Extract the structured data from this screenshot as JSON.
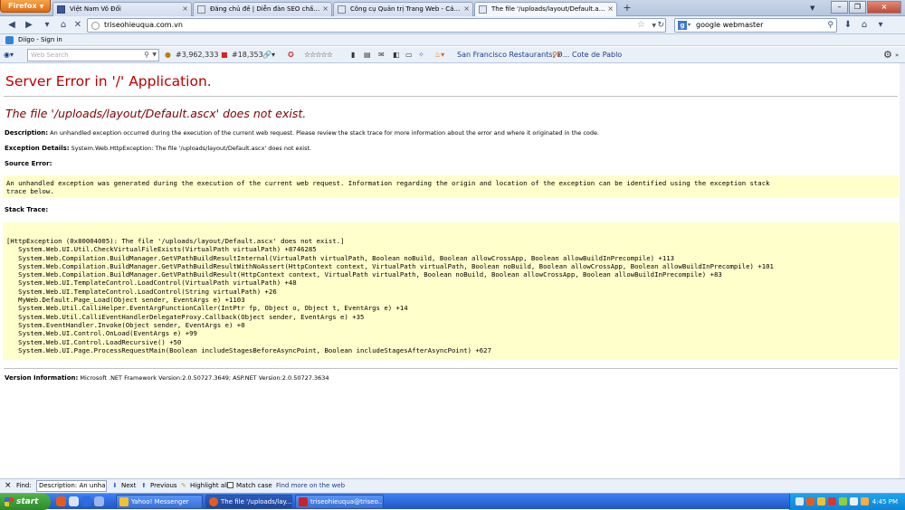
{
  "browser": {
    "menu_button": "Firefox",
    "tabs": [
      {
        "title": "Việt Nam Vô Đối",
        "active": false
      },
      {
        "title": "Đăng chủ đề | Diễn đàn SEO chất lượng ...",
        "active": false
      },
      {
        "title": "Công cụ Quản trị Trang Web - Các liên kế...",
        "active": false
      },
      {
        "title": "The file '/uploads/layout/Default.ascx' do...",
        "active": true
      }
    ],
    "new_tab": "+",
    "url": "triseohieuqua.com.vn",
    "search_engine_icon": "g-icon",
    "search_value": "google webmaster"
  },
  "diigo": {
    "label": "Diigo - Sign in"
  },
  "addon_toolbar": {
    "search_placeholder": "Web Search",
    "alexa_rank": "#3,962,333",
    "vn_rank": "#18,353",
    "stars": "☆☆☆☆☆",
    "restaurant_link": "San Francisco Restaurants, D...",
    "place_link": "Cote de Pablo"
  },
  "page": {
    "title": "Server Error in '/' Application.",
    "message": "The file '/uploads/layout/Default.ascx' does not exist.",
    "description_label": "Description:",
    "description_text": "An unhandled exception occurred during the execution of the current web request. Please review the stack trace for more information about the error and where it originated in the code.",
    "exception_label": "Exception Details:",
    "exception_text": "System.Web.HttpException: The file '/uploads/layout/Default.ascx' does not exist.",
    "source_error_label": "Source Error:",
    "source_error_lines": [
      "An unhandled exception was generated during the execution of the current web request. Information regarding the origin and location of the exception can be identified using the exception stack",
      "trace below."
    ],
    "stack_trace_label": "Stack Trace:",
    "stack_trace_lines": [
      "[HttpException (0x80004005): The file '/uploads/layout/Default.ascx' does not exist.]",
      "   System.Web.UI.Util.CheckVirtualFileExists(VirtualPath virtualPath) +8746285",
      "   System.Web.Compilation.BuildManager.GetVPathBuildResultInternal(VirtualPath virtualPath, Boolean noBuild, Boolean allowCrossApp, Boolean allowBuildInPrecompile) +113",
      "   System.Web.Compilation.BuildManager.GetVPathBuildResultWithNoAssert(HttpContext context, VirtualPath virtualPath, Boolean noBuild, Boolean allowCrossApp, Boolean allowBuildInPrecompile) +101",
      "   System.Web.Compilation.BuildManager.GetVPathBuildResult(HttpContext context, VirtualPath virtualPath, Boolean noBuild, Boolean allowCrossApp, Boolean allowBuildInPrecompile) +83",
      "   System.Web.UI.TemplateControl.LoadControl(VirtualPath virtualPath) +48",
      "   System.Web.UI.TemplateControl.LoadControl(String virtualPath) +26",
      "   MyWeb.Default.Page_Load(Object sender, EventArgs e) +1103",
      "   System.Web.Util.CalliHelper.EventArgFunctionCaller(IntPtr fp, Object o, Object t, EventArgs e) +14",
      "   System.Web.Util.CalliEventHandlerDelegateProxy.Callback(Object sender, EventArgs e) +35",
      "   System.EventHandler.Invoke(Object sender, EventArgs e) +0",
      "   System.Web.UI.Control.OnLoad(EventArgs e) +99",
      "   System.Web.UI.Control.LoadRecursive() +50",
      "   System.Web.UI.Page.ProcessRequestMain(Boolean includeStagesBeforeAsyncPoint, Boolean includeStagesAfterAsyncPoint) +627"
    ],
    "version_label": "Version Information:",
    "version_text": "Microsoft .NET Framework Version:2.0.50727.3649; ASP.NET Version:2.0.50727.3634",
    "colors": {
      "title": "#b00000",
      "message": "#800000",
      "code_bg": "#ffffcc"
    }
  },
  "findbar": {
    "close": "×",
    "label": "Find:",
    "value": "Description: An unhandle",
    "next": "Next",
    "previous": "Previous",
    "highlight": "Highlight all",
    "match_case": "Match case",
    "web_link": "Find more on the web"
  },
  "taskbar": {
    "start": "start",
    "tasks": [
      {
        "title": "Yahoo! Messenger",
        "active": false
      },
      {
        "title": "The file '/uploads/lay...",
        "active": true
      },
      {
        "title": "triseohieuqua@triseo...",
        "active": false
      }
    ],
    "clock": "4:45 PM"
  }
}
